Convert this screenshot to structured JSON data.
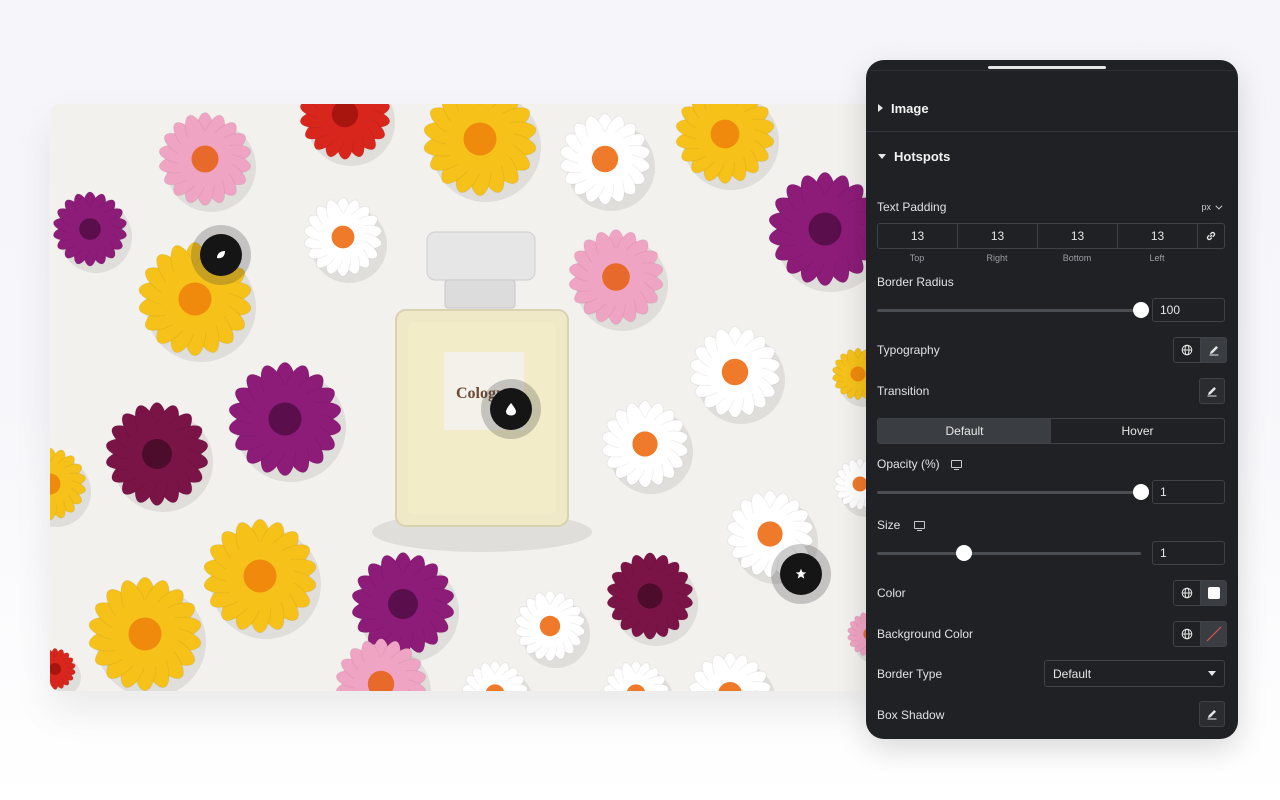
{
  "hotspots": [
    {
      "icon": "leaf-icon"
    },
    {
      "icon": "drop-icon"
    },
    {
      "icon": "star-icon"
    }
  ],
  "bottle_label": "Cologne",
  "panel": {
    "image_section": "Image",
    "hotspots_section": "Hotspots",
    "text_padding": {
      "label": "Text Padding",
      "unit": "px",
      "values": [
        "13",
        "13",
        "13",
        "13"
      ],
      "sides": [
        "Top",
        "Right",
        "Bottom",
        "Left"
      ]
    },
    "border_radius": {
      "label": "Border Radius",
      "value": "100",
      "fraction": 1.0
    },
    "typography": {
      "label": "Typography"
    },
    "transition": {
      "label": "Transition"
    },
    "state_tabs": [
      "Default",
      "Hover"
    ],
    "active_tab": "Default",
    "opacity": {
      "label": "Opacity (%)",
      "value": "1",
      "fraction": 1.0
    },
    "size": {
      "label": "Size",
      "value": "1",
      "fraction": 0.33
    },
    "color": {
      "label": "Color",
      "swatch": "#ffffff"
    },
    "background_color": {
      "label": "Background Color",
      "swatch": "none"
    },
    "border_type": {
      "label": "Border Type",
      "value": "Default"
    },
    "box_shadow": {
      "label": "Box Shadow"
    }
  },
  "colors": {
    "panel_bg": "#1f2124",
    "accent_flower_yellow": "#f5c518",
    "accent_flower_magenta": "#8e1f7a",
    "accent_flower_pink": "#ef9fbe"
  }
}
